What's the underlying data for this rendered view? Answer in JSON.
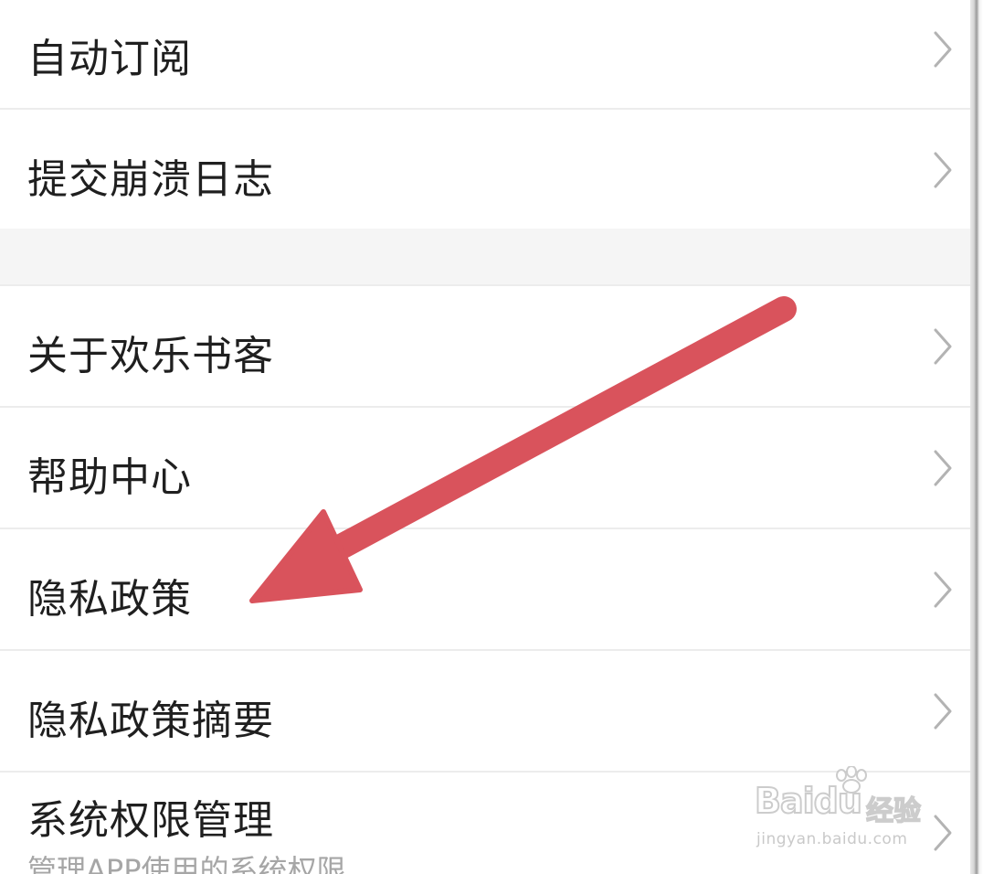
{
  "settings_list": {
    "items": [
      {
        "label": "自动订阅"
      },
      {
        "label": "提交崩溃日志"
      },
      {
        "label": "关于欢乐书客"
      },
      {
        "label": "帮助中心"
      },
      {
        "label": "隐私政策"
      },
      {
        "label": "隐私政策摘要"
      },
      {
        "label": "系统权限管理",
        "sublabel": "管理APP使用的系统权限"
      }
    ]
  },
  "chevron_icon": "chevron-right-icon",
  "annotation": {
    "arrow_color": "#d9535c",
    "points_to": "隐私政策"
  },
  "watermark": {
    "logo": "Baidu",
    "brand": "经验",
    "url": "jingyan.baidu.com"
  },
  "colors": {
    "background": "#ffffff",
    "section_gap": "#f5f5f5",
    "divider": "#ececec",
    "text": "#1f1f1f",
    "subtext": "#a6a6a6",
    "chevron": "#b3b3b3"
  }
}
